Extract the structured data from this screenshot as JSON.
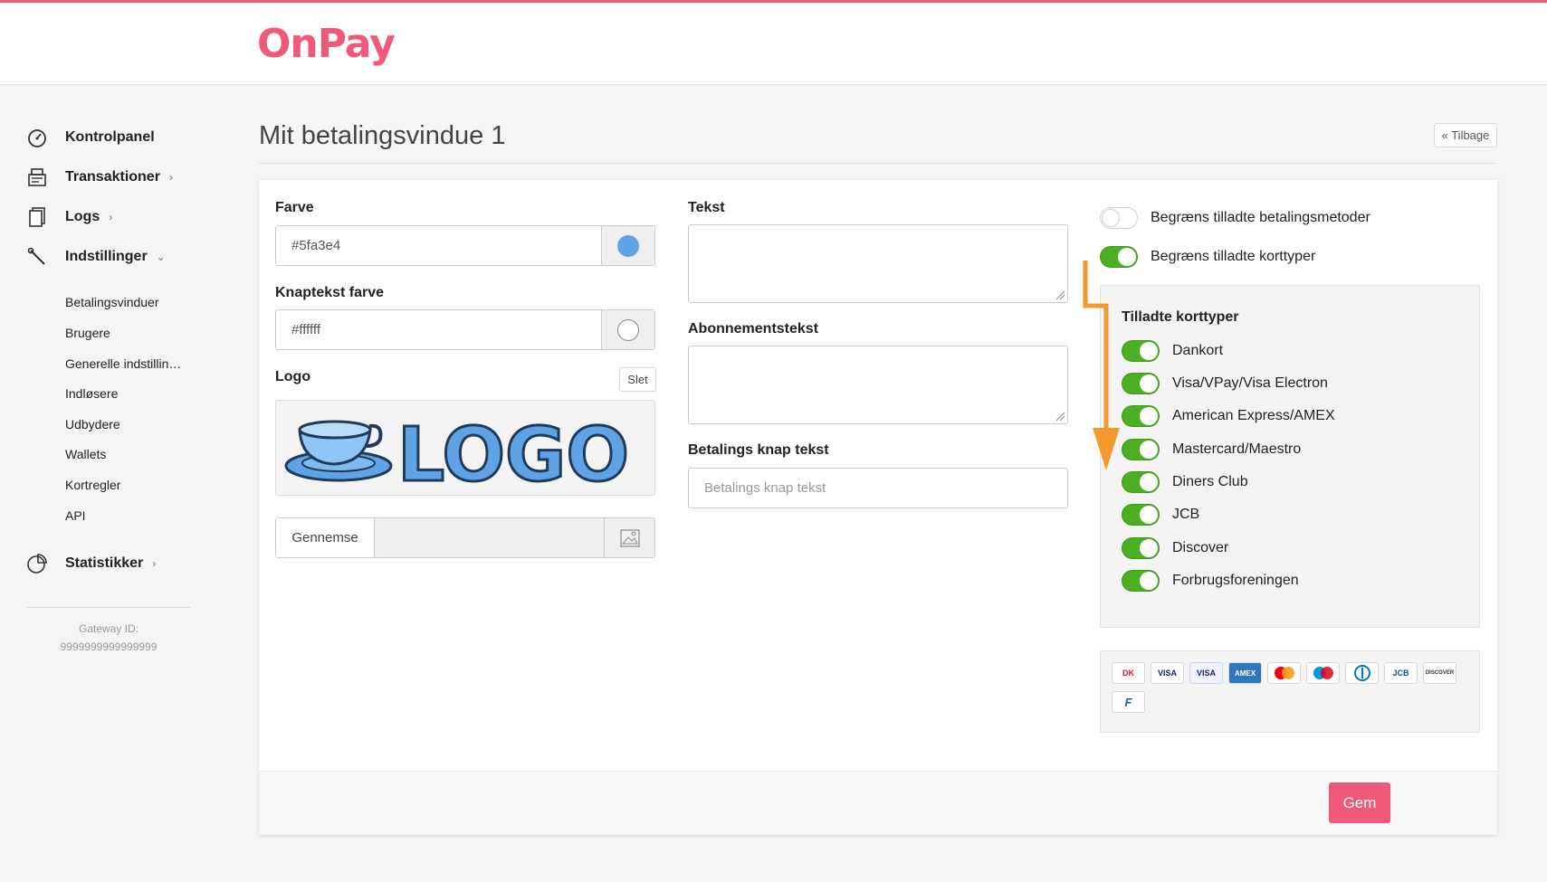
{
  "brand": {
    "name": "OnPay",
    "color": "#f05a78"
  },
  "sidebar": {
    "main_items": [
      {
        "label": "Kontrolpanel",
        "icon": "speedometer-icon"
      },
      {
        "label": "Transaktioner",
        "icon": "register-icon",
        "chevron": "›"
      },
      {
        "label": "Logs",
        "icon": "documents-icon",
        "chevron": "›"
      },
      {
        "label": "Indstillinger",
        "icon": "wrench-icon",
        "chevron": "⌄"
      }
    ],
    "sub_items": [
      "Betalingsvinduer",
      "Brugere",
      "Generelle indstillin…",
      "Indløsere",
      "Udbydere",
      "Wallets",
      "Kortregler",
      "API"
    ],
    "stats": {
      "label": "Statistikker",
      "icon": "pie-chart-icon",
      "chevron": "›"
    },
    "gateway_label": "Gateway ID:",
    "gateway_value": "9999999999999999"
  },
  "header": {
    "title": "Mit betalingsvindue 1",
    "back_label": "« Tilbage"
  },
  "form": {
    "color_label": "Farve",
    "color_value": "#5fa3e4",
    "color_swatch": "#5fa3e4",
    "button_text_color_label": "Knaptekst farve",
    "button_text_color_value": "#ffffff",
    "button_text_color_swatch": "#ffffff",
    "logo_label": "Logo",
    "logo_delete": "Slet",
    "logo_text": "LOGO",
    "browse_label": "Gennemse",
    "text_label": "Tekst",
    "text_value": "",
    "subscription_label": "Abonnementstekst",
    "subscription_value": "",
    "pay_button_label": "Betalings knap tekst",
    "pay_button_placeholder": "Betalings knap tekst"
  },
  "restrictions": {
    "methods_label": "Begræns tilladte betalingsmetoder",
    "methods_on": false,
    "cardtypes_label": "Begræns tilladte korttyper",
    "cardtypes_on": true
  },
  "card_panel": {
    "title": "Tilladte korttyper",
    "cards": [
      {
        "label": "Dankort",
        "on": true
      },
      {
        "label": "Visa/VPay/Visa Electron",
        "on": true
      },
      {
        "label": "American Express/AMEX",
        "on": true
      },
      {
        "label": "Mastercard/Maestro",
        "on": true
      },
      {
        "label": "Diners Club",
        "on": true
      },
      {
        "label": "JCB",
        "on": true
      },
      {
        "label": "Discover",
        "on": true
      },
      {
        "label": "Forbrugsforeningen",
        "on": true
      }
    ]
  },
  "card_icons": [
    {
      "name": "dankort-icon",
      "text": "DK"
    },
    {
      "name": "visa-icon",
      "text": "VISA"
    },
    {
      "name": "visa-electron-icon",
      "text": "VISA"
    },
    {
      "name": "amex-icon",
      "text": "AMEX"
    },
    {
      "name": "mastercard-icon",
      "text": ""
    },
    {
      "name": "maestro-icon",
      "text": ""
    },
    {
      "name": "diners-icon",
      "text": ""
    },
    {
      "name": "jcb-icon",
      "text": "JCB"
    },
    {
      "name": "discover-icon",
      "text": "DISCOVER"
    },
    {
      "name": "forbrugsforeningen-icon",
      "text": "F"
    }
  ],
  "save_label": "Gem",
  "colors": {
    "toggle_on": "#4caf22",
    "accent": "#f05a78",
    "arrow": "#f29a2e"
  }
}
